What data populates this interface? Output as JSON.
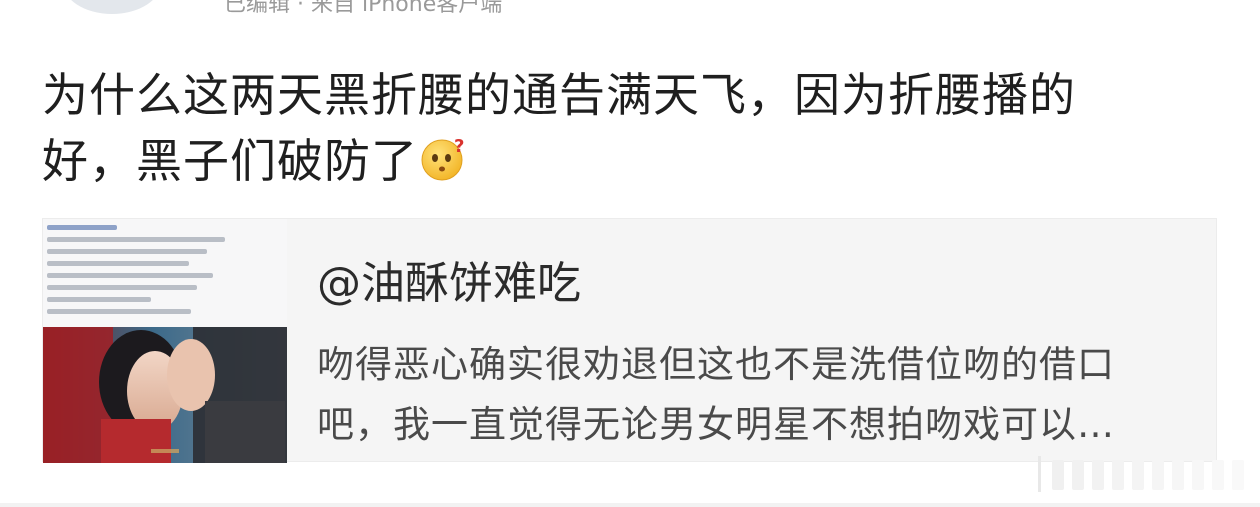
{
  "header": {
    "meta": "已编辑 · 来自 iPhone客户端"
  },
  "post": {
    "text_line1": "为什么这两天黑折腰的通告满天飞，因为折腰播的",
    "text_line2": "好，黑子们破防了",
    "emoji": "confused-face-emoji"
  },
  "quoted_card": {
    "username": "@油酥饼难吃",
    "line1": "吻得恶心确实很劝退但这也不是洗借位吻的借口",
    "line2": "吧，我一直觉得无论男女明星不想拍吻戏可以…",
    "thumbnail": "kiss-scene-screenshot-image"
  },
  "colors": {
    "text": "#1f1f1f",
    "card_bg": "#f5f5f5",
    "card_text": "#4a4a4a"
  }
}
